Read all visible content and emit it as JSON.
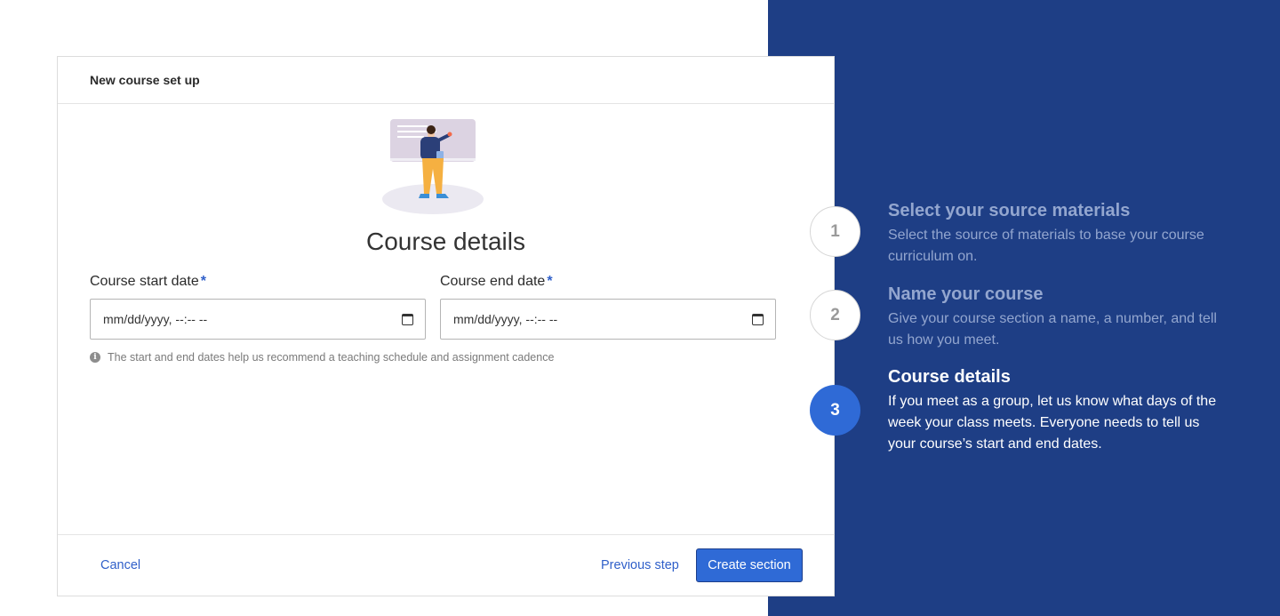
{
  "modal": {
    "header_title": "New course set up",
    "title": "Course details",
    "start_field": {
      "label": "Course start date",
      "required_mark": "*",
      "value": "mm/dd/yyyy, --:-- --"
    },
    "end_field": {
      "label": "Course end date",
      "required_mark": "*",
      "value": "mm/dd/yyyy, --:-- --"
    },
    "hint": "The start and end dates help us recommend a teaching schedule and assignment cadence",
    "info_icon_glyph": "i",
    "footer": {
      "cancel_label": "Cancel",
      "previous_label": "Previous step",
      "create_label": "Create section"
    }
  },
  "steps": [
    {
      "number": "1",
      "title": "Select your source materials",
      "description": "Select the source of materials to base your course curriculum on.",
      "state": "done"
    },
    {
      "number": "2",
      "title": "Name your course",
      "description": "Give your course section a name, a number, and tell us how you meet.",
      "state": "done"
    },
    {
      "number": "3",
      "title": "Course details",
      "description": "If you meet as a group, let us know what days of the week your class meets. Everyone needs to tell us your course’s start and end dates.",
      "state": "current"
    }
  ],
  "icons": {
    "calendar": "calendar-icon",
    "info": "info-icon",
    "illustration": "teacher-presenting-illustration"
  },
  "colors": {
    "panel_bg": "#1e3e85",
    "accent": "#2f6ad6",
    "link": "#2f5fc9"
  }
}
